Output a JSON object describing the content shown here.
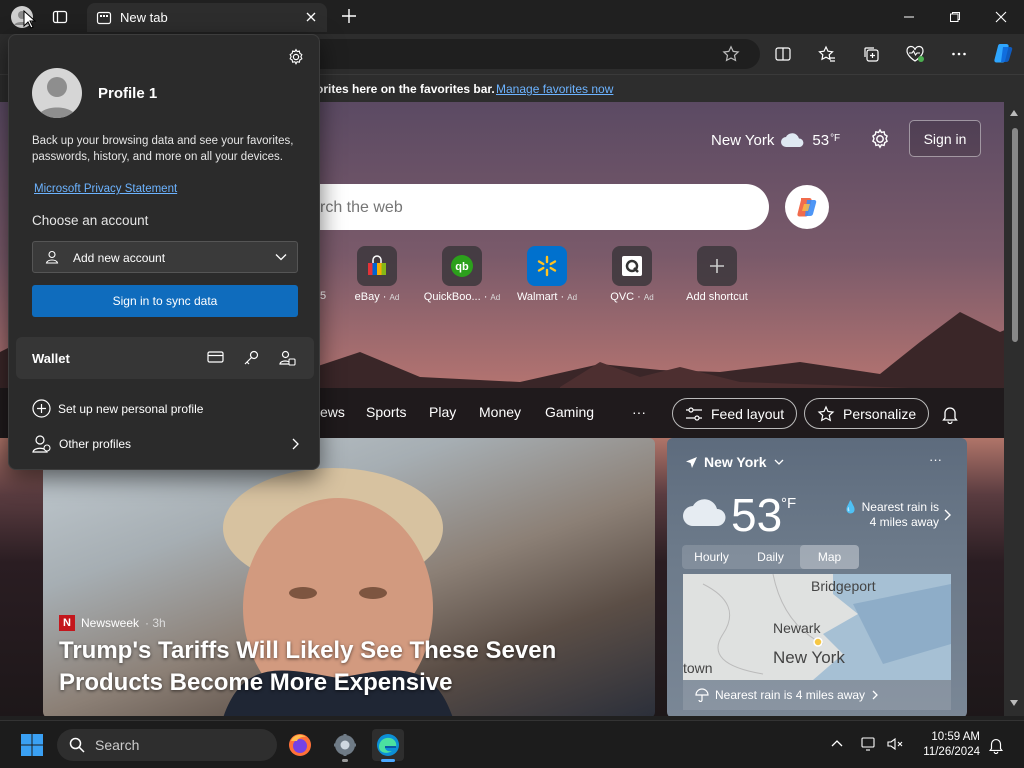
{
  "browser": {
    "tab_title": "New tab",
    "favorites_bar_text": "Show your favorites here on the favorites bar.",
    "favorites_bar_visible_text": "orites here on the favorites bar.",
    "manage_favorites_link": "Manage favorites now"
  },
  "profile_flyout": {
    "profile_name": "Profile 1",
    "description": "Back up your browsing data and see your favorites, passwords, history, and more on all your devices.",
    "privacy_link": "Microsoft Privacy Statement",
    "choose_account_label": "Choose an account",
    "account_select_value": "Add new account",
    "sync_button": "Sign in to sync data",
    "wallet_label": "Wallet",
    "new_profile_label": "Set up new personal profile",
    "other_profiles_label": "Other profiles"
  },
  "new_tab_page": {
    "location": "New York",
    "temperature": "53",
    "temp_unit": "°F",
    "sign_in_button": "Sign in",
    "search_placeholder": "Search the web",
    "search_visible_placeholder": "rch the web",
    "shortcuts": [
      {
        "label": "eBay",
        "ad": "Ad",
        "icon": "ebay-icon"
      },
      {
        "label": "QuickBoo...",
        "ad": "Ad",
        "icon": "quickbooks-icon"
      },
      {
        "label": "Walmart",
        "ad": "Ad",
        "icon": "walmart-icon"
      },
      {
        "label": "QVC",
        "ad": "Ad",
        "icon": "qvc-icon"
      },
      {
        "label": "Add shortcut",
        "ad": "",
        "icon": "plus-icon"
      }
    ],
    "partial_shortcut_text": "5",
    "feed_tabs": [
      "ews",
      "Sports",
      "Play",
      "Money",
      "Gaming"
    ],
    "more_label": "···",
    "feed_layout_button": "Feed layout",
    "personalize_button": "Personalize"
  },
  "news_card": {
    "source": "Newsweek",
    "age": "· 3h",
    "headline": "Trump's Tariffs Will Likely See These Seven Products Become More Expensive"
  },
  "weather_card": {
    "location": "New York",
    "temperature": "53",
    "unit": "°F",
    "rain_note": "Nearest rain is 4 miles away",
    "tabs": [
      "Hourly",
      "Daily",
      "Map"
    ],
    "active_tab": "Map",
    "map_labels": [
      "Bridgeport",
      "Newark",
      "New York",
      "town"
    ],
    "nearest_rain_bar": "Nearest rain is 4 miles away"
  },
  "taskbar": {
    "search_label": "Search",
    "time": "10:59 AM",
    "date": "11/26/2024"
  },
  "colors": {
    "accent": "#0f6cbd",
    "link": "#6cb3ff",
    "flyout_bg": "#2b2b2b"
  }
}
